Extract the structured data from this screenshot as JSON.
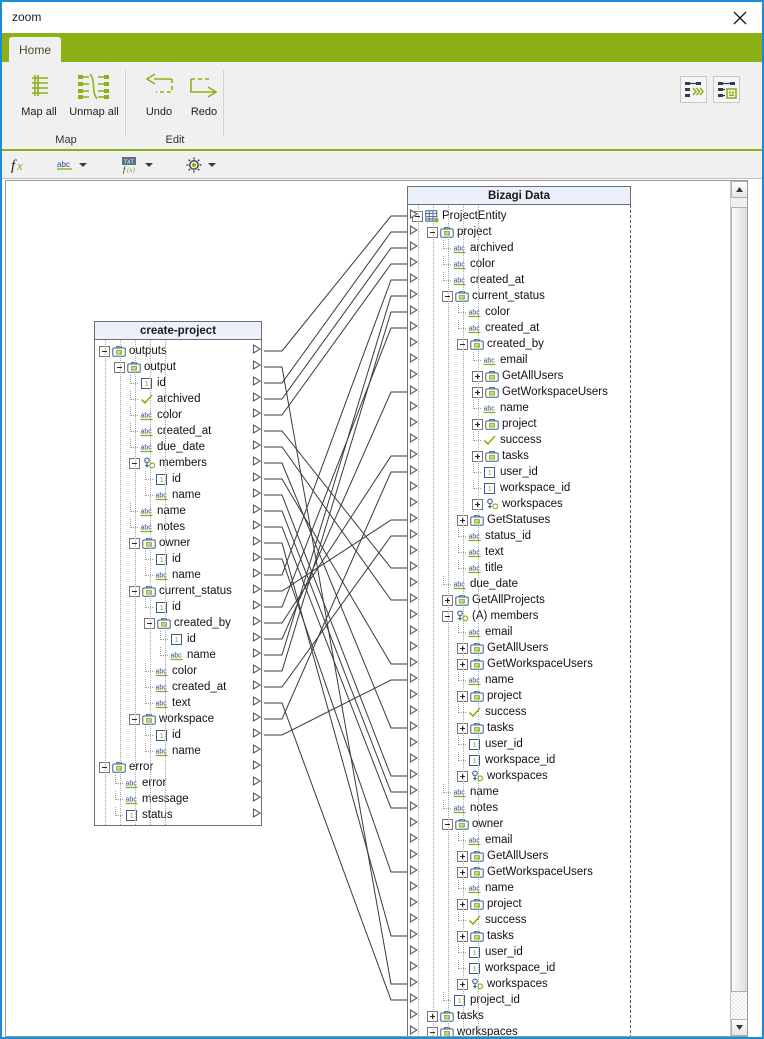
{
  "window": {
    "title": "zoom",
    "close_icon": "close-icon",
    "accent_border": "#1a8cd8"
  },
  "ribbon": {
    "accent": "#8cb115",
    "tabs": [
      {
        "label": "Home",
        "active": true
      }
    ],
    "groups": [
      {
        "name": "Map",
        "label": "Map",
        "buttons": [
          {
            "label": "Map all",
            "icon": "map-all-icon"
          },
          {
            "label": "Unmap all",
            "icon": "unmap-all-icon"
          }
        ]
      },
      {
        "name": "Edit",
        "label": "Edit",
        "buttons": [
          {
            "label": "Undo",
            "icon": "undo-icon"
          },
          {
            "label": "Redo",
            "icon": "redo-icon"
          }
        ]
      }
    ],
    "right_toggles": [
      {
        "icon": "auto-map-icon",
        "label": ""
      },
      {
        "icon": "show-details-icon",
        "label": ""
      }
    ]
  },
  "formula_bar": {
    "items": [
      {
        "icon": "fx-icon",
        "has_caret": false
      },
      {
        "icon": "abc-icon",
        "has_caret": true
      },
      {
        "icon": "expression-icon",
        "has_caret": true
      },
      {
        "icon": "gear-icon",
        "has_caret": true
      }
    ]
  },
  "canvas": {
    "scrollbar": {
      "up_icon": "scroll-up-icon",
      "down_icon": "scroll-down-icon",
      "thumb_top_pct": 3,
      "thumb_height_pct": 92
    }
  },
  "source_panel": {
    "title": "create-project",
    "rows": [
      {
        "depth": 0,
        "label": "outputs",
        "icon": "object-icon",
        "expander": "minus"
      },
      {
        "depth": 1,
        "label": "output",
        "icon": "object-icon",
        "expander": "minus"
      },
      {
        "depth": 2,
        "label": "id",
        "icon": "number-icon",
        "expander": "none"
      },
      {
        "depth": 2,
        "label": "archived",
        "icon": "boolean-icon",
        "expander": "none"
      },
      {
        "depth": 2,
        "label": "color",
        "icon": "text-icon",
        "expander": "none"
      },
      {
        "depth": 2,
        "label": "created_at",
        "icon": "text-icon",
        "expander": "none"
      },
      {
        "depth": 2,
        "label": "due_date",
        "icon": "text-icon",
        "expander": "none"
      },
      {
        "depth": 2,
        "label": "members",
        "icon": "collection-icon",
        "expander": "minus"
      },
      {
        "depth": 3,
        "label": "id",
        "icon": "number-icon",
        "expander": "none"
      },
      {
        "depth": 3,
        "label": "name",
        "icon": "text-icon",
        "expander": "none"
      },
      {
        "depth": 2,
        "label": "name",
        "icon": "text-icon",
        "expander": "none"
      },
      {
        "depth": 2,
        "label": "notes",
        "icon": "text-icon",
        "expander": "none"
      },
      {
        "depth": 2,
        "label": "owner",
        "icon": "object-icon",
        "expander": "minus"
      },
      {
        "depth": 3,
        "label": "id",
        "icon": "number-icon",
        "expander": "none"
      },
      {
        "depth": 3,
        "label": "name",
        "icon": "text-icon",
        "expander": "none"
      },
      {
        "depth": 2,
        "label": "current_status",
        "icon": "object-icon",
        "expander": "minus"
      },
      {
        "depth": 3,
        "label": "id",
        "icon": "number-icon",
        "expander": "none"
      },
      {
        "depth": 3,
        "label": "created_by",
        "icon": "object-icon",
        "expander": "minus"
      },
      {
        "depth": 4,
        "label": "id",
        "icon": "number-icon",
        "expander": "none"
      },
      {
        "depth": 4,
        "label": "name",
        "icon": "text-icon",
        "expander": "none"
      },
      {
        "depth": 3,
        "label": "color",
        "icon": "text-icon",
        "expander": "none"
      },
      {
        "depth": 3,
        "label": "created_at",
        "icon": "text-icon",
        "expander": "none"
      },
      {
        "depth": 3,
        "label": "text",
        "icon": "text-icon",
        "expander": "none"
      },
      {
        "depth": 2,
        "label": "workspace",
        "icon": "object-icon",
        "expander": "minus"
      },
      {
        "depth": 3,
        "label": "id",
        "icon": "number-icon",
        "expander": "none"
      },
      {
        "depth": 3,
        "label": "name",
        "icon": "text-icon",
        "expander": "none"
      },
      {
        "depth": 0,
        "label": "error",
        "icon": "object-icon",
        "expander": "minus"
      },
      {
        "depth": 1,
        "label": "error",
        "icon": "text-icon",
        "expander": "none"
      },
      {
        "depth": 1,
        "label": "message",
        "icon": "text-icon",
        "expander": "none"
      },
      {
        "depth": 1,
        "label": "status",
        "icon": "number-icon",
        "expander": "none"
      }
    ]
  },
  "target_panel": {
    "title": "Bizagi Data",
    "rows": [
      {
        "depth": 0,
        "label": "ProjectEntity",
        "icon": "entity-icon",
        "expander": "minus"
      },
      {
        "depth": 1,
        "label": "project",
        "icon": "object-icon",
        "expander": "minus"
      },
      {
        "depth": 2,
        "label": "archived",
        "icon": "text-icon",
        "expander": "none"
      },
      {
        "depth": 2,
        "label": "color",
        "icon": "text-icon",
        "expander": "none"
      },
      {
        "depth": 2,
        "label": "created_at",
        "icon": "text-icon",
        "expander": "none"
      },
      {
        "depth": 2,
        "label": "current_status",
        "icon": "object-icon",
        "expander": "minus"
      },
      {
        "depth": 3,
        "label": "color",
        "icon": "text-icon",
        "expander": "none"
      },
      {
        "depth": 3,
        "label": "created_at",
        "icon": "text-icon",
        "expander": "none"
      },
      {
        "depth": 3,
        "label": "created_by",
        "icon": "object-icon",
        "expander": "minus"
      },
      {
        "depth": 4,
        "label": "email",
        "icon": "text-icon",
        "expander": "none"
      },
      {
        "depth": 4,
        "label": "GetAllUsers",
        "icon": "object-icon",
        "expander": "plus"
      },
      {
        "depth": 4,
        "label": "GetWorkspaceUsers",
        "icon": "object-icon",
        "expander": "plus"
      },
      {
        "depth": 4,
        "label": "name",
        "icon": "text-icon",
        "expander": "none"
      },
      {
        "depth": 4,
        "label": "project",
        "icon": "object-icon",
        "expander": "plus"
      },
      {
        "depth": 4,
        "label": "success",
        "icon": "boolean-icon",
        "expander": "none"
      },
      {
        "depth": 4,
        "label": "tasks",
        "icon": "object-icon",
        "expander": "plus"
      },
      {
        "depth": 4,
        "label": "user_id",
        "icon": "number-icon",
        "expander": "none"
      },
      {
        "depth": 4,
        "label": "workspace_id",
        "icon": "number-icon",
        "expander": "none"
      },
      {
        "depth": 4,
        "label": "workspaces",
        "icon": "collection-icon",
        "expander": "plus"
      },
      {
        "depth": 3,
        "label": "GetStatuses",
        "icon": "object-icon",
        "expander": "plus"
      },
      {
        "depth": 3,
        "label": "status_id",
        "icon": "text-icon",
        "expander": "none"
      },
      {
        "depth": 3,
        "label": "text",
        "icon": "text-icon",
        "expander": "none"
      },
      {
        "depth": 3,
        "label": "title",
        "icon": "text-icon",
        "expander": "none"
      },
      {
        "depth": 2,
        "label": "due_date",
        "icon": "text-icon",
        "expander": "none"
      },
      {
        "depth": 2,
        "label": "GetAllProjects",
        "icon": "object-icon",
        "expander": "plus"
      },
      {
        "depth": 2,
        "label": "(A) members",
        "icon": "collection-icon",
        "expander": "minus"
      },
      {
        "depth": 3,
        "label": "email",
        "icon": "text-icon",
        "expander": "none"
      },
      {
        "depth": 3,
        "label": "GetAllUsers",
        "icon": "object-icon",
        "expander": "plus"
      },
      {
        "depth": 3,
        "label": "GetWorkspaceUsers",
        "icon": "object-icon",
        "expander": "plus"
      },
      {
        "depth": 3,
        "label": "name",
        "icon": "text-icon",
        "expander": "none"
      },
      {
        "depth": 3,
        "label": "project",
        "icon": "object-icon",
        "expander": "plus"
      },
      {
        "depth": 3,
        "label": "success",
        "icon": "boolean-icon",
        "expander": "none"
      },
      {
        "depth": 3,
        "label": "tasks",
        "icon": "object-icon",
        "expander": "plus"
      },
      {
        "depth": 3,
        "label": "user_id",
        "icon": "number-icon",
        "expander": "none"
      },
      {
        "depth": 3,
        "label": "workspace_id",
        "icon": "number-icon",
        "expander": "none"
      },
      {
        "depth": 3,
        "label": "workspaces",
        "icon": "collection-icon",
        "expander": "plus"
      },
      {
        "depth": 2,
        "label": "name",
        "icon": "text-icon",
        "expander": "none"
      },
      {
        "depth": 2,
        "label": "notes",
        "icon": "text-icon",
        "expander": "none"
      },
      {
        "depth": 2,
        "label": "owner",
        "icon": "object-icon",
        "expander": "minus"
      },
      {
        "depth": 3,
        "label": "email",
        "icon": "text-icon",
        "expander": "none"
      },
      {
        "depth": 3,
        "label": "GetAllUsers",
        "icon": "object-icon",
        "expander": "plus"
      },
      {
        "depth": 3,
        "label": "GetWorkspaceUsers",
        "icon": "object-icon",
        "expander": "plus"
      },
      {
        "depth": 3,
        "label": "name",
        "icon": "text-icon",
        "expander": "none"
      },
      {
        "depth": 3,
        "label": "project",
        "icon": "object-icon",
        "expander": "plus"
      },
      {
        "depth": 3,
        "label": "success",
        "icon": "boolean-icon",
        "expander": "none"
      },
      {
        "depth": 3,
        "label": "tasks",
        "icon": "object-icon",
        "expander": "plus"
      },
      {
        "depth": 3,
        "label": "user_id",
        "icon": "number-icon",
        "expander": "none"
      },
      {
        "depth": 3,
        "label": "workspace_id",
        "icon": "number-icon",
        "expander": "none"
      },
      {
        "depth": 3,
        "label": "workspaces",
        "icon": "collection-icon",
        "expander": "plus"
      },
      {
        "depth": 2,
        "label": "project_id",
        "icon": "number-icon",
        "expander": "none"
      },
      {
        "depth": 1,
        "label": "tasks",
        "icon": "object-icon",
        "expander": "plus"
      },
      {
        "depth": 1,
        "label": "workspaces",
        "icon": "object-icon",
        "expander": "minus"
      }
    ]
  },
  "mappings": [
    {
      "source_row": 1,
      "target_row": 1
    },
    {
      "source_row": 2,
      "target_row": 49
    },
    {
      "source_row": 3,
      "target_row": 2
    },
    {
      "source_row": 4,
      "target_row": 3
    },
    {
      "source_row": 5,
      "target_row": 4
    },
    {
      "source_row": 6,
      "target_row": 23
    },
    {
      "source_row": 7,
      "target_row": 25
    },
    {
      "source_row": 8,
      "target_row": 33
    },
    {
      "source_row": 9,
      "target_row": 29
    },
    {
      "source_row": 10,
      "target_row": 36
    },
    {
      "source_row": 11,
      "target_row": 37
    },
    {
      "source_row": 12,
      "target_row": 38
    },
    {
      "source_row": 13,
      "target_row": 46
    },
    {
      "source_row": 14,
      "target_row": 42
    },
    {
      "source_row": 15,
      "target_row": 5
    },
    {
      "source_row": 16,
      "target_row": 20
    },
    {
      "source_row": 17,
      "target_row": 8
    },
    {
      "source_row": 18,
      "target_row": 16
    },
    {
      "source_row": 19,
      "target_row": 12
    },
    {
      "source_row": 20,
      "target_row": 6
    },
    {
      "source_row": 21,
      "target_row": 7
    },
    {
      "source_row": 22,
      "target_row": 21
    },
    {
      "source_row": 23,
      "target_row": 50
    },
    {
      "source_row": 24,
      "target_row": 17
    },
    {
      "source_row": 25,
      "target_row": 30
    }
  ]
}
